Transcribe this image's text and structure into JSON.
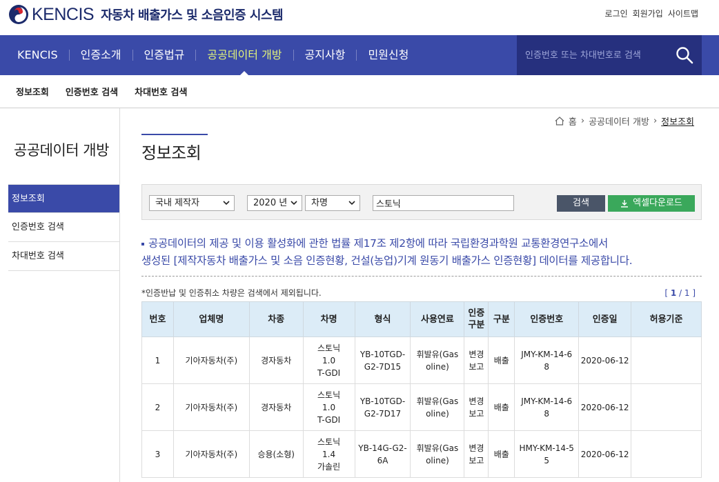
{
  "header": {
    "logo_text": "KENCIS",
    "logo_subtitle": "자동차 배출가스 및 소음인증 시스템",
    "util_links": [
      "로그인",
      "회원가입",
      "사이트맵"
    ]
  },
  "gnb": {
    "items": [
      "KENCIS",
      "인증소개",
      "인증법규",
      "공공데이터 개방",
      "공지사항",
      "민원신청"
    ],
    "active_index": 3,
    "search_placeholder": "인증번호 또는 차대번호로 검색"
  },
  "subnav": [
    "정보조회",
    "인증번호 검색",
    "차대번호 검색"
  ],
  "sidebar": {
    "title": "공공데이터 개방",
    "items": [
      "정보조회",
      "인증번호 검색",
      "차대번호 검색"
    ],
    "active_index": 0
  },
  "breadcrumb": [
    "홈",
    "공공데이터 개방",
    "정보조회"
  ],
  "page_title": "정보조회",
  "search": {
    "maker_select": "국내 제작자",
    "year_select": "2020 년",
    "field_select": "차명",
    "keyword": "스토닉",
    "search_label": "검색",
    "excel_label": "엑셀다운로드"
  },
  "notice": {
    "line1": "공공데이터의 제공 및 이용 활성화에 관한 법률 제17조 제2항에 따라 국립환경과학원 교통환경연구소에서",
    "line2": "생성된 [제작자동차 배출가스 및 소음 인증현황, 건설(농업)기계 원동기 배출가스 인증현황] 데이터를 제공합니다."
  },
  "table_note": "*인증반납 및 인증취소 차량은 검색에서 제외됩니다.",
  "pager": {
    "current": "1",
    "total": "1"
  },
  "table": {
    "headers": [
      "번호",
      "업체명",
      "차종",
      "차명",
      "형식",
      "사용연료",
      "인증\n구분",
      "구분",
      "인증번호",
      "인증일",
      "허용기준"
    ],
    "rows": [
      [
        "1",
        "기아자동차(주)",
        "경자동차",
        "스토닉\n1.0\nT-GDI",
        "YB-10TGD-\nG2-7D15",
        "휘발유(Gas\noline)",
        "변경\n보고",
        "배출",
        "JMY-KM-14-6\n8",
        "2020-06-12",
        ""
      ],
      [
        "2",
        "기아자동차(주)",
        "경자동차",
        "스토닉\n1.0\nT-GDI",
        "YB-10TGD-\nG2-7D17",
        "휘발유(Gas\noline)",
        "변경\n보고",
        "배출",
        "JMY-KM-14-6\n8",
        "2020-06-12",
        ""
      ],
      [
        "3",
        "기아자동차(주)",
        "승용(소형)",
        "스토닉\n1.4\n가솔린",
        "YB-14G-G2-\n6A",
        "휘발유(Gas\noline)",
        "변경\n보고",
        "배출",
        "HMY-KM-14-5\n5",
        "2020-06-12",
        ""
      ]
    ]
  },
  "colors": {
    "brand_blue": "#3a4aa8",
    "search_dark": "#26307e",
    "active_menu_text": "#e3f47a",
    "excel_green": "#3aa85b",
    "table_header_bg": "#dcecf7"
  }
}
